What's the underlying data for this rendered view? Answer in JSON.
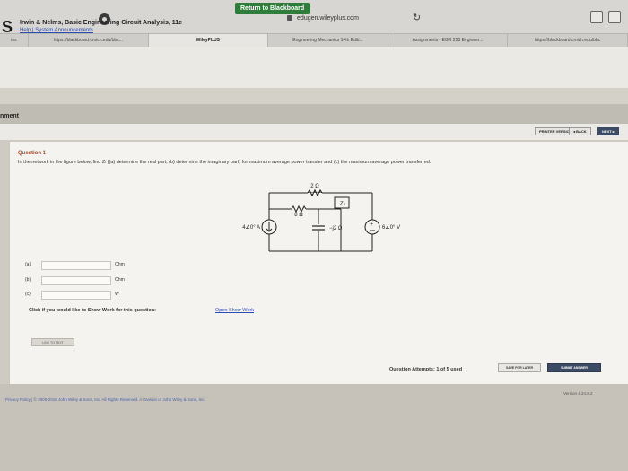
{
  "browser": {
    "url": "edugen.wileyplus.com",
    "tabs": [
      "ins",
      "https://blackboard.cmich.edu/bbc...",
      "WileyPLUS",
      "Engineering Mechanics 14th Editi...",
      "Assignments - EGR 253 Engineer...",
      "https://blackboard.cmich.edu/bbc"
    ]
  },
  "header": {
    "return_label": "Return to Blackboard",
    "brand_letter": "S",
    "book_title": "Irwin & Nelms, Basic Engineering Circuit Analysis, 11e",
    "help_links": "Help | System Announcements"
  },
  "assignment_label": "nment",
  "nav": {
    "printer": "PRINTER VERSION",
    "back": "◂ BACK",
    "next": "NEXT ▸"
  },
  "question": {
    "title": "Question 1",
    "text": "In the network in the figure below, find Zₗ ((a) determine the real part, (b) determine the imaginary part) for maximum average power transfer and (c) the maximum average power transferred."
  },
  "circuit": {
    "r_top": "2 Ω",
    "r_mid": "8 Ω",
    "zl": "Zₗ",
    "current_source": "4∠0° A",
    "capacitor": "−j2 Ω",
    "voltage_source": "6∠0° V"
  },
  "answers": [
    {
      "label": "(a)",
      "unit": "Ohm"
    },
    {
      "label": "(b)",
      "unit": "Ohm"
    },
    {
      "label": "(c)",
      "unit": "W"
    }
  ],
  "show_work": {
    "prompt": "Click if you would like to Show Work for this question:",
    "link": "Open Show Work"
  },
  "link_to_text": "LINK TO TEXT",
  "attempts": "Question Attempts: 1 of 5 used",
  "buttons": {
    "save_later": "SAVE FOR LATER",
    "submit": "SUBMIT ANSWER"
  },
  "footer": {
    "text": "Privacy Policy  |  © 2000-2018 John Wiley & Sons, Inc. All Rights Reserved. A Division of John Wiley & Sons, Inc.",
    "version": "Version 4.24.8.2"
  }
}
